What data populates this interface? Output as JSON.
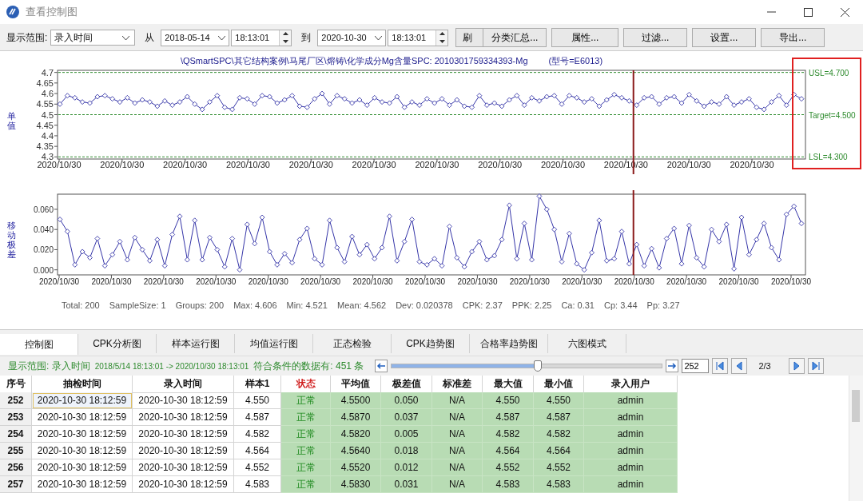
{
  "window": {
    "title": "查看控制图"
  },
  "toolbar": {
    "range_label": "显示范围:",
    "range_field": {
      "value": "录入时间"
    },
    "from_label": "从",
    "from_date": "2018-05-14",
    "from_time": "18:13:01",
    "to_label": "到",
    "to_date": "2020-10-30",
    "to_time": "18:13:01",
    "buttons": [
      "刷",
      "分类汇总...",
      "属性...",
      "过滤...",
      "设置...",
      "导出..."
    ]
  },
  "chart_title": "\\QSmartSPC\\其它结构案例\\马尾厂区\\熔铸\\化学成分Mg含量SPC: 2010301759334393-Mg",
  "chart_note": "(型号=E6013)",
  "charts": [
    {
      "kind": "individuals",
      "x_ticks": [
        "2020/10/30",
        "2020/10/30",
        "2020/10/30",
        "2020/10/30",
        "2020/10/30",
        "2020/10/30",
        "2020/10/30",
        "2020/10/30",
        "2020/10/30",
        "2020/10/30",
        "2020/10/30",
        "2020/10/30"
      ],
      "chart_data": {
        "type": "line",
        "ylabel": "单值",
        "ylim": [
          4.29,
          4.71
        ],
        "yticks": [
          4.3,
          4.35,
          4.4,
          4.45,
          4.5,
          4.55,
          4.6,
          4.65,
          4.7
        ],
        "series": [
          {
            "color": "#3535a8",
            "marker": "diamond",
            "values": [
              4.55,
              4.59,
              4.58,
              4.56,
              4.555,
              4.585,
              4.59,
              4.575,
              4.56,
              4.58,
              4.555,
              4.57,
              4.56,
              4.54,
              4.565,
              4.545,
              4.56,
              4.585,
              4.55,
              4.525,
              4.56,
              4.59,
              4.535,
              4.525,
              4.58,
              4.575,
              4.55,
              4.59,
              4.585,
              4.555,
              4.57,
              4.59,
              4.54,
              4.535,
              4.575,
              4.6,
              4.55,
              4.59,
              4.575,
              4.555,
              4.57,
              4.545,
              4.58,
              4.56,
              4.555,
              4.585,
              4.535,
              4.56,
              4.545,
              4.575,
              4.555,
              4.575,
              4.545,
              4.57,
              4.54,
              4.535,
              4.59,
              4.545,
              4.555,
              4.54,
              4.57,
              4.59,
              4.545,
              4.58,
              4.565,
              4.585,
              4.59,
              4.55,
              4.59,
              4.58,
              4.56,
              4.575,
              4.54,
              4.57,
              4.595,
              4.58,
              4.565,
              4.545,
              4.58,
              4.585,
              4.55,
              4.58,
              4.585,
              4.555,
              4.595,
              4.565,
              4.54,
              4.56,
              4.55,
              4.585,
              4.545,
              4.56,
              4.575,
              4.535,
              4.525,
              4.56,
              4.59,
              4.545,
              4.595,
              4.575
            ]
          }
        ],
        "ref_lines": [
          {
            "axis": "y",
            "value": 4.7,
            "label": "USL=4.700"
          },
          {
            "axis": "y",
            "value": 4.5,
            "label": "Target=4.500"
          },
          {
            "axis": "y",
            "value": 4.3,
            "label": "LSL=4.300"
          }
        ]
      }
    },
    {
      "kind": "moving_range",
      "chart_data": {
        "type": "line",
        "ylabel": "移动极差",
        "ylim": [
          -0.005,
          0.075
        ],
        "yticks": [
          {
            "value": 0,
            "label": "0.000"
          },
          {
            "value": 0.02,
            "label": "0.020"
          },
          {
            "value": 0.04,
            "label": "0.040"
          },
          {
            "value": 0.06,
            "label": "0.060"
          }
        ],
        "series": [
          {
            "color": "#3535a8",
            "marker": "diamond",
            "values": [
              0.05,
              0.038,
              0.005,
              0.018,
              0.012,
              0.031,
              0.004,
              0.015,
              0.028,
              0.01,
              0.032,
              0.02,
              0.009,
              0.03,
              0.004,
              0.035,
              0.053,
              0.01,
              0.049,
              0.01,
              0.032,
              0.02,
              0.003,
              0.031,
              0.0,
              0.045,
              0.026,
              0.052,
              0.018,
              0.005,
              0.016,
              0.007,
              0.03,
              0.041,
              0.011,
              0.005,
              0.049,
              0.022,
              0.008,
              0.033,
              0.015,
              0.025,
              0.011,
              0.022,
              0.053,
              0.009,
              0.028,
              0.05,
              0.008,
              0.005,
              0.011,
              0.004,
              0.043,
              0.012,
              0.003,
              0.018,
              0.028,
              0.01,
              0.014,
              0.03,
              0.064,
              0.011,
              0.046,
              0.01,
              0.073,
              0.06,
              0.04,
              0.008,
              0.036,
              0.006,
              0.0,
              0.017,
              0.049,
              0.009,
              0.011,
              0.038,
              0.006,
              0.025,
              0.004,
              0.021,
              0.002,
              0.031,
              0.041,
              0.006,
              0.044,
              0.012,
              0.003,
              0.04,
              0.028,
              0.045,
              0.001,
              0.052,
              0.015,
              0.03,
              0.046,
              0.022,
              0.01,
              0.055,
              0.063,
              0.046
            ]
          }
        ]
      },
      "x_ticks": [
        "2020/10/30",
        "2020/10/30",
        "2020/10/30",
        "2020/10/30",
        "2020/10/30",
        "2020/10/30",
        "2020/10/30",
        "2020/10/30",
        "2020/10/30",
        "2020/10/30",
        "2020/10/30",
        "2020/10/30",
        "2020/10/30",
        "2020/10/30",
        "2020/10/30"
      ]
    }
  ],
  "stats": [
    "Total: 200",
    "SampleSize: 1",
    "Groups: 200",
    "Max: 4.606",
    "Min: 4.521",
    "Mean: 4.562",
    "Dev: 0.020378",
    "CPK: 2.37",
    "PPK: 2.25",
    "Ca: 0.31",
    "Cp: 3.44",
    "Pp: 3.27"
  ],
  "tabs": [
    {
      "label": "控制图",
      "selected": true
    },
    {
      "label": "CPK分析图",
      "selected": false
    },
    {
      "label": "样本运行图",
      "selected": false
    },
    {
      "label": "均值运行图",
      "selected": false
    },
    {
      "label": "正态检验",
      "selected": false
    },
    {
      "label": "CPK趋势图",
      "selected": false
    },
    {
      "label": "合格率趋势图",
      "selected": false
    },
    {
      "label": "六图模式",
      "selected": false
    }
  ],
  "status": {
    "range_label": "显示范围: 录入时间",
    "range_text": "2018/5/14 18:13:01 -> 2020/10/30 18:13:01",
    "count_text": "符合条件的数据有: 451 条",
    "slider": {
      "level": 0.54
    },
    "page_field": "252",
    "page_text": "2/3"
  },
  "table": {
    "columns": [
      {
        "label": "序号",
        "kind": "index"
      },
      {
        "label": "抽检时间",
        "kind": "plain"
      },
      {
        "label": "录入时间",
        "kind": "plain"
      },
      {
        "label": "样本1",
        "kind": "plain"
      },
      {
        "label": "状态",
        "kind": "status"
      },
      {
        "label": "平均值",
        "kind": "metric"
      },
      {
        "label": "极差值",
        "kind": "metric"
      },
      {
        "label": "标准差",
        "kind": "metric"
      },
      {
        "label": "最大值",
        "kind": "metric"
      },
      {
        "label": "最小值",
        "kind": "metric"
      },
      {
        "label": "录入用户",
        "kind": "metric"
      }
    ],
    "rows": [
      {
        "selected": true,
        "cells": [
          "252",
          "2020-10-30 18:12:59",
          "2020-10-30 18:12:59",
          "4.550",
          "正常",
          "4.5500",
          "0.050",
          "N/A",
          "4.550",
          "4.550",
          "admin"
        ]
      },
      {
        "selected": false,
        "cells": [
          "253",
          "2020-10-30 18:12:59",
          "2020-10-30 18:12:59",
          "4.587",
          "正常",
          "4.5870",
          "0.037",
          "N/A",
          "4.587",
          "4.587",
          "admin"
        ]
      },
      {
        "selected": false,
        "cells": [
          "254",
          "2020-10-30 18:12:59",
          "2020-10-30 18:12:59",
          "4.582",
          "正常",
          "4.5820",
          "0.005",
          "N/A",
          "4.582",
          "4.582",
          "admin"
        ]
      },
      {
        "selected": false,
        "cells": [
          "255",
          "2020-10-30 18:12:59",
          "2020-10-30 18:12:59",
          "4.564",
          "正常",
          "4.5640",
          "0.018",
          "N/A",
          "4.564",
          "4.564",
          "admin"
        ]
      },
      {
        "selected": false,
        "cells": [
          "256",
          "2020-10-30 18:12:59",
          "2020-10-30 18:12:59",
          "4.552",
          "正常",
          "4.5520",
          "0.012",
          "N/A",
          "4.552",
          "4.552",
          "admin"
        ]
      },
      {
        "selected": false,
        "cells": [
          "257",
          "2020-10-30 18:12:59",
          "2020-10-30 18:12:59",
          "4.583",
          "正常",
          "4.5830",
          "0.031",
          "N/A",
          "4.583",
          "4.583",
          "admin"
        ]
      }
    ]
  }
}
